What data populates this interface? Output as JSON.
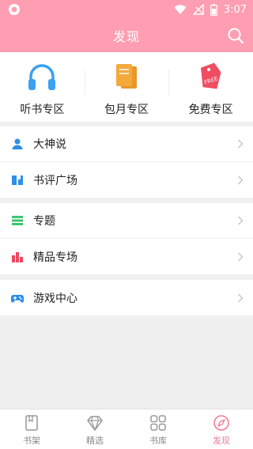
{
  "status_bar": {
    "time": "3:07"
  },
  "header": {
    "title": "发现"
  },
  "quick_links": [
    {
      "label": "听书专区",
      "icon": "headphones-icon"
    },
    {
      "label": "包月专区",
      "icon": "books-icon"
    },
    {
      "label": "免费专区",
      "icon": "free-tag-icon",
      "badge": "FREE"
    }
  ],
  "menu_groups": [
    [
      {
        "label": "大神说",
        "icon": "person-icon"
      },
      {
        "label": "书评广场",
        "icon": "book-review-icon"
      }
    ],
    [
      {
        "label": "专题",
        "icon": "topic-list-icon"
      },
      {
        "label": "精品专场",
        "icon": "bar-chart-icon"
      }
    ],
    [
      {
        "label": "游戏中心",
        "icon": "gamepad-icon"
      }
    ]
  ],
  "tabs": [
    {
      "label": "书架",
      "icon": "bookshelf-icon",
      "active": false
    },
    {
      "label": "精选",
      "icon": "diamond-icon",
      "active": false
    },
    {
      "label": "书库",
      "icon": "grid-icon",
      "active": false
    },
    {
      "label": "发现",
      "icon": "compass-icon",
      "active": true
    }
  ],
  "colors": {
    "header_bg": "#ff9eb2",
    "tab_active": "#f07d96",
    "page_bg": "#f0f0f0"
  }
}
